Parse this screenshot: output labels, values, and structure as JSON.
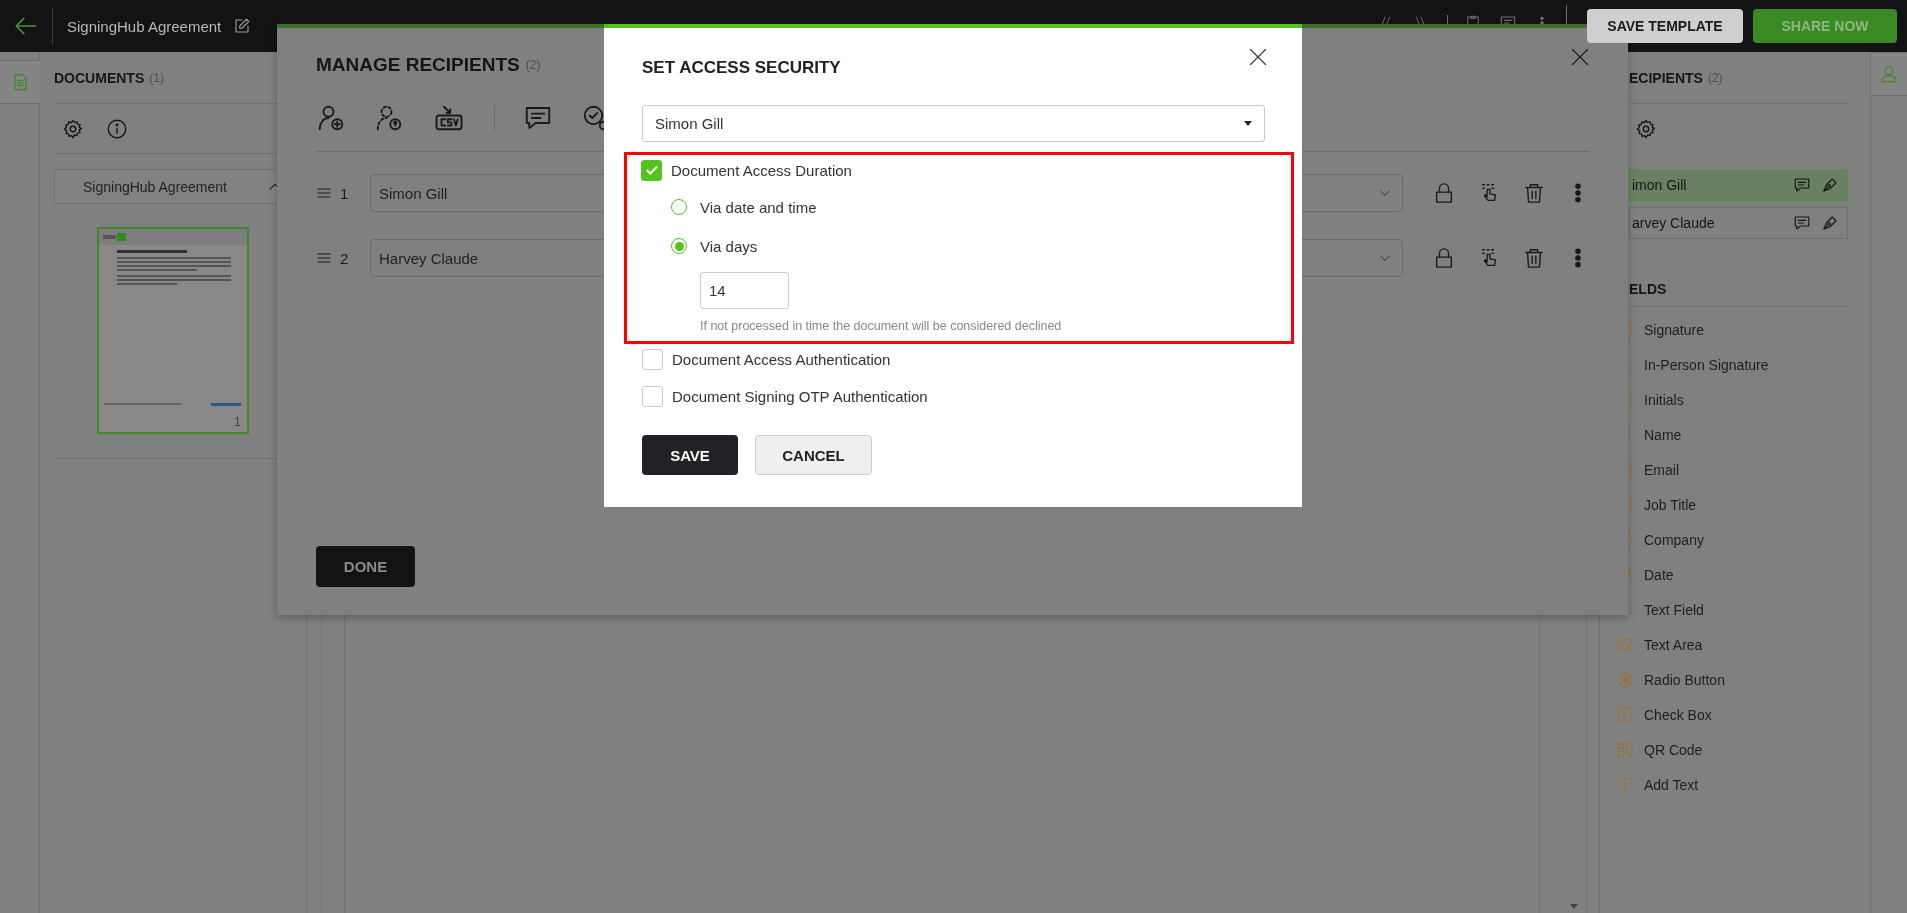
{
  "top_bar": {
    "title": "SigningHub Agreement",
    "buttons": [
      {
        "label": "SAVE TEMPLATE",
        "kind": "secondary"
      },
      {
        "label": "SHARE NOW",
        "kind": "primary"
      }
    ]
  },
  "documents_panel": {
    "title": "DOCUMENTS",
    "count": "(1)",
    "document": {
      "name": "SigningHub Agreement",
      "expanded": true,
      "page_number": "1"
    }
  },
  "recipients_panel": {
    "title": "ECIPIENTS",
    "count": "(2)",
    "recipients": [
      {
        "name": "imon Gill",
        "selected": true
      },
      {
        "name": "arvey Claude",
        "selected": false
      }
    ],
    "fields_title": "ELDS",
    "fields": [
      {
        "label": "Signature",
        "kind": "signature"
      },
      {
        "label": "In-Person Signature",
        "kind": "person"
      },
      {
        "label": "Initials",
        "kind": "initials"
      },
      {
        "label": "Name",
        "kind": "name"
      },
      {
        "label": "Email",
        "kind": "email"
      },
      {
        "label": "Job Title",
        "kind": "job"
      },
      {
        "label": "Company",
        "kind": "company"
      },
      {
        "label": "Date",
        "kind": "date"
      },
      {
        "label": "Text Field",
        "kind": "textfield"
      },
      {
        "label": "Text Area",
        "kind": "textarea"
      },
      {
        "label": "Radio Button",
        "kind": "radio"
      },
      {
        "label": "Check Box",
        "kind": "checkbox"
      },
      {
        "label": "QR Code",
        "kind": "qr"
      },
      {
        "label": "Add Text",
        "kind": "text"
      }
    ]
  },
  "manage_recipients": {
    "title": "MANAGE RECIPIENTS",
    "count": "(2)",
    "recipients": [
      {
        "order": "1",
        "name": "Simon Gill"
      },
      {
        "order": "2",
        "name": "Harvey Claude"
      }
    ],
    "done_label": "DONE"
  },
  "access_security": {
    "title": "SET ACCESS SECURITY",
    "recipient": "Simon Gill",
    "options": [
      {
        "kind": "checkbox",
        "label": "Document Access Duration",
        "checked": true,
        "highlighted": true,
        "choices": [
          {
            "label": "Via date and time",
            "selected": false
          },
          {
            "label": "Via days",
            "selected": true
          }
        ],
        "days": "14",
        "hint": "If not processed in time the document will be considered declined"
      },
      {
        "kind": "checkbox",
        "label": "Document Access Authentication",
        "checked": false,
        "highlighted": false
      },
      {
        "kind": "checkbox",
        "label": "Document Signing OTP Authentication",
        "checked": false,
        "highlighted": false
      }
    ],
    "buttons": [
      {
        "label": "SAVE",
        "kind": "primary"
      },
      {
        "label": "CANCEL",
        "kind": "secondary"
      }
    ]
  }
}
